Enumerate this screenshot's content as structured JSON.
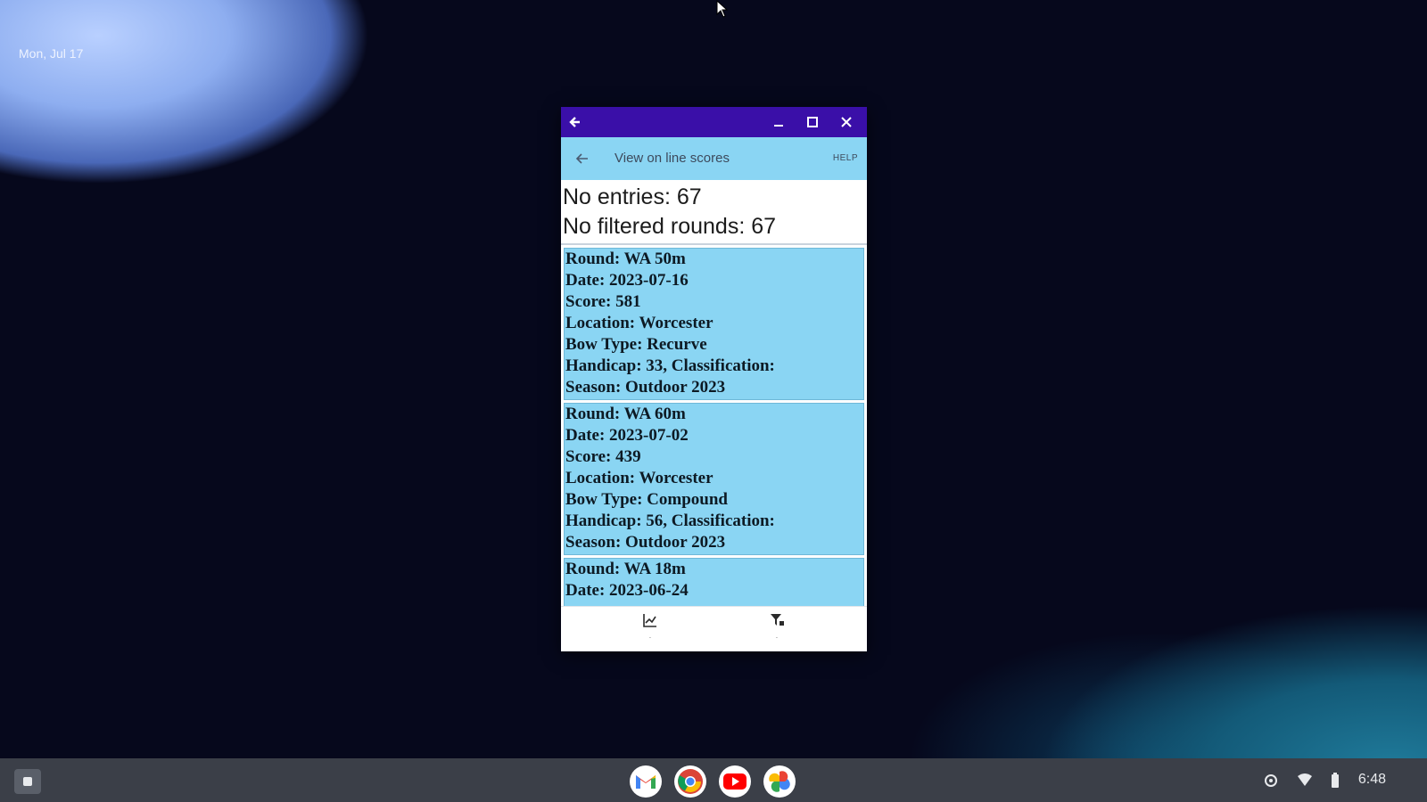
{
  "desktop": {
    "date": "Mon, Jul 17"
  },
  "window": {
    "titlebar": {
      "back_icon": "arrow-left-icon",
      "minimize_icon": "minimize-icon",
      "maximize_icon": "maximize-icon",
      "close_icon": "close-icon"
    },
    "appbar": {
      "title": "View on line scores",
      "help": "HELP"
    },
    "summary": {
      "entries": "No entries: 67",
      "filtered": "No filtered rounds: 67"
    },
    "rounds": [
      {
        "round": "Round: WA 50m",
        "date": "Date: 2023-07-16",
        "score": "Score: 581",
        "location": "Location: Worcester",
        "bow": "Bow Type: Recurve",
        "handicap": "Handicap: 33, Classification:",
        "season": "Season: Outdoor 2023"
      },
      {
        "round": "Round: WA 60m",
        "date": "Date: 2023-07-02",
        "score": "Score: 439",
        "location": "Location: Worcester",
        "bow": "Bow Type: Compound",
        "handicap": "Handicap: 56, Classification:",
        "season": "Season: Outdoor 2023"
      },
      {
        "round": "Round: WA 18m",
        "date": "Date: 2023-06-24"
      }
    ],
    "bottom_nav": {
      "chart_icon": "chart-icon",
      "filter_icon": "filter-icon"
    }
  },
  "taskbar": {
    "apps": [
      "Gmail",
      "Chrome",
      "YouTube",
      "Photos"
    ],
    "time": "6:48"
  },
  "colors": {
    "titlebar": "#3a0fa8",
    "accent": "#8ad5f3",
    "taskbar": "#3b3f48"
  }
}
